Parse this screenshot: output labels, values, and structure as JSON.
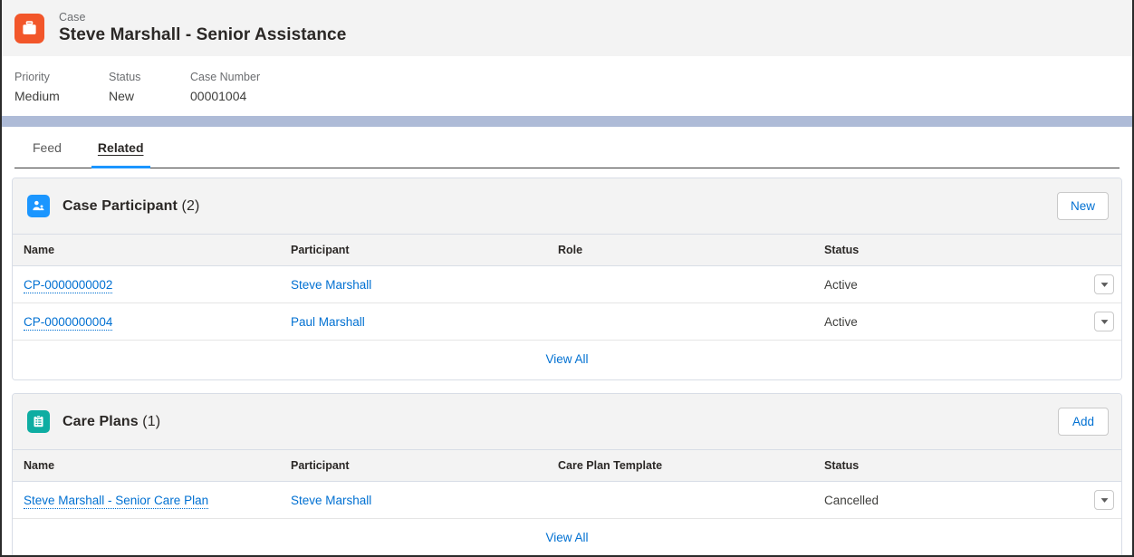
{
  "record": {
    "object_label": "Case",
    "title": "Steve Marshall - Senior Assistance",
    "icon": "briefcase-icon",
    "icon_color": "#f2562a",
    "highlights": [
      {
        "label": "Priority",
        "value": "Medium"
      },
      {
        "label": "Status",
        "value": "New"
      },
      {
        "label": "Case Number",
        "value": "00001004"
      }
    ]
  },
  "tabs": [
    {
      "label": "Feed",
      "active": false
    },
    {
      "label": "Related",
      "active": true
    }
  ],
  "accent_color": "#1b96ff",
  "link_color": "#0070d2",
  "related_lists": [
    {
      "icon": "person-account-icon",
      "icon_color": "#1b96ff",
      "title": "Case Participant",
      "count": "(2)",
      "action_label": "New",
      "columns": [
        "Name",
        "Participant",
        "Role",
        "Status"
      ],
      "rows": [
        {
          "name": "CP-0000000002",
          "participant": "Steve Marshall",
          "role": "",
          "status": "Active",
          "row_action": "chevron-down-icon"
        },
        {
          "name": "CP-0000000004",
          "participant": "Paul Marshall",
          "role": "",
          "status": "Active",
          "row_action": "chevron-down-icon"
        }
      ],
      "footer_label": "View All"
    },
    {
      "icon": "clipboard-icon",
      "icon_color": "#0eada2",
      "title": "Care Plans",
      "count": "(1)",
      "action_label": "Add",
      "columns": [
        "Name",
        "Participant",
        "Care Plan Template",
        "Status"
      ],
      "rows": [
        {
          "name": "Steve Marshall - Senior Care Plan",
          "participant": "Steve Marshall",
          "role": "",
          "status": "Cancelled",
          "row_action": "chevron-down-icon"
        }
      ],
      "footer_label": "View All"
    }
  ]
}
